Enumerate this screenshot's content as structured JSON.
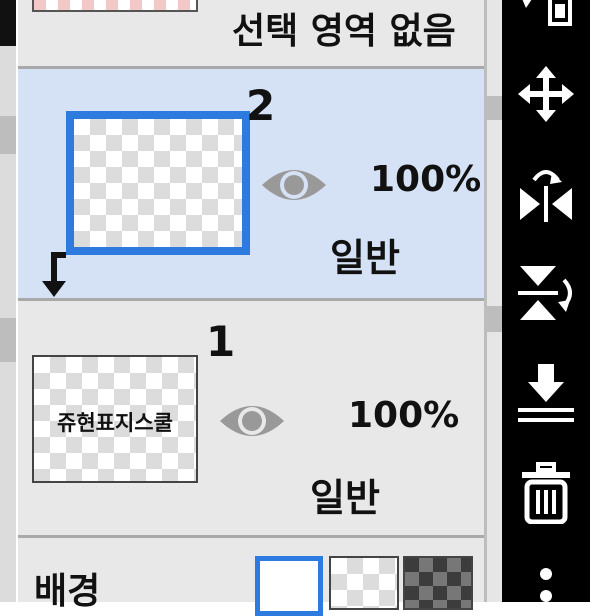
{
  "selection_row": {
    "label": "선택 영역 없음"
  },
  "layers": [
    {
      "number": "2",
      "opacity": "100%",
      "blend_mode": "일반",
      "thumbnail_text": ""
    },
    {
      "number": "1",
      "opacity": "100%",
      "blend_mode": "일반",
      "thumbnail_text": "쥬현표지스쿨"
    }
  ],
  "background_row": {
    "label": "배경"
  },
  "colors": {
    "selected_row": "#d5e2f5",
    "selected_border": "#2e7be0",
    "panel": "#e8e8e8",
    "toolbar": "#000000",
    "eye": "#999999"
  },
  "toolbar_icons": [
    "layer-transfer-icon",
    "move-icon",
    "flip-horizontal-icon",
    "flip-vertical-icon",
    "merge-down-icon",
    "trash-icon",
    "more-icon"
  ]
}
